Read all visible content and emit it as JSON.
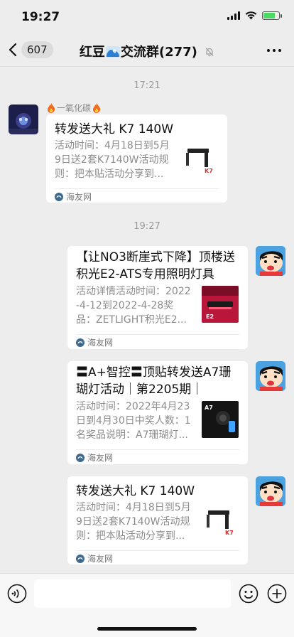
{
  "status_bar": {
    "time": "19:27",
    "battery_level": 0.75
  },
  "nav": {
    "back_count": "607",
    "title_part1": "红豆",
    "title_part2": "交流群(277)"
  },
  "chat": {
    "timestamps": [
      "17:21",
      "19:27"
    ],
    "sender_name": "一氧化碳",
    "messages": [
      {
        "title": "转发送大礼 K7 140W",
        "desc_lines": [
          "活动时间：4月18日到5月",
          "9日送2套K7140W活动规",
          "则：把本贴活动分享到..."
        ],
        "source": "海友网",
        "thumb_label": "K7"
      },
      {
        "title_lines": [
          "【让NO3断崖式下降】顶楼送",
          "积光E2-ATS专用照明灯具"
        ],
        "desc_lines": [
          "活动详情活动时间：2022",
          "-4-12到2022-4-28奖",
          "品：ZETLIGHT积光E2..."
        ],
        "source": "海友网",
        "thumb_label": "E2"
      },
      {
        "title_lines": [
          "〓A+智控〓顶贴转发送A7珊",
          "瑚灯活动｜第2205期｜"
        ],
        "desc_lines": [
          "活动时间：2022年4月23",
          "日到4月30日中奖人数：1",
          "名奖品说明：A7珊瑚灯..."
        ],
        "source": "海友网",
        "thumb_label": "A7"
      },
      {
        "title": "转发送大礼 K7 140W",
        "desc_lines": [
          "活动时间：4月18日到5月",
          "9日送2套K7140W活动规",
          "则：把本贴活动分享到..."
        ],
        "source": "海友网",
        "thumb_label": "K7"
      }
    ]
  },
  "icons": {
    "back": "chevron-left-icon",
    "mute": "mute-bell-icon",
    "more": "more-icon",
    "voice": "voice-icon",
    "emoji": "emoji-icon",
    "plus": "plus-icon"
  },
  "colors": {
    "background": "#ededed",
    "card": "#ffffff",
    "accent_red": "#e8333a"
  }
}
